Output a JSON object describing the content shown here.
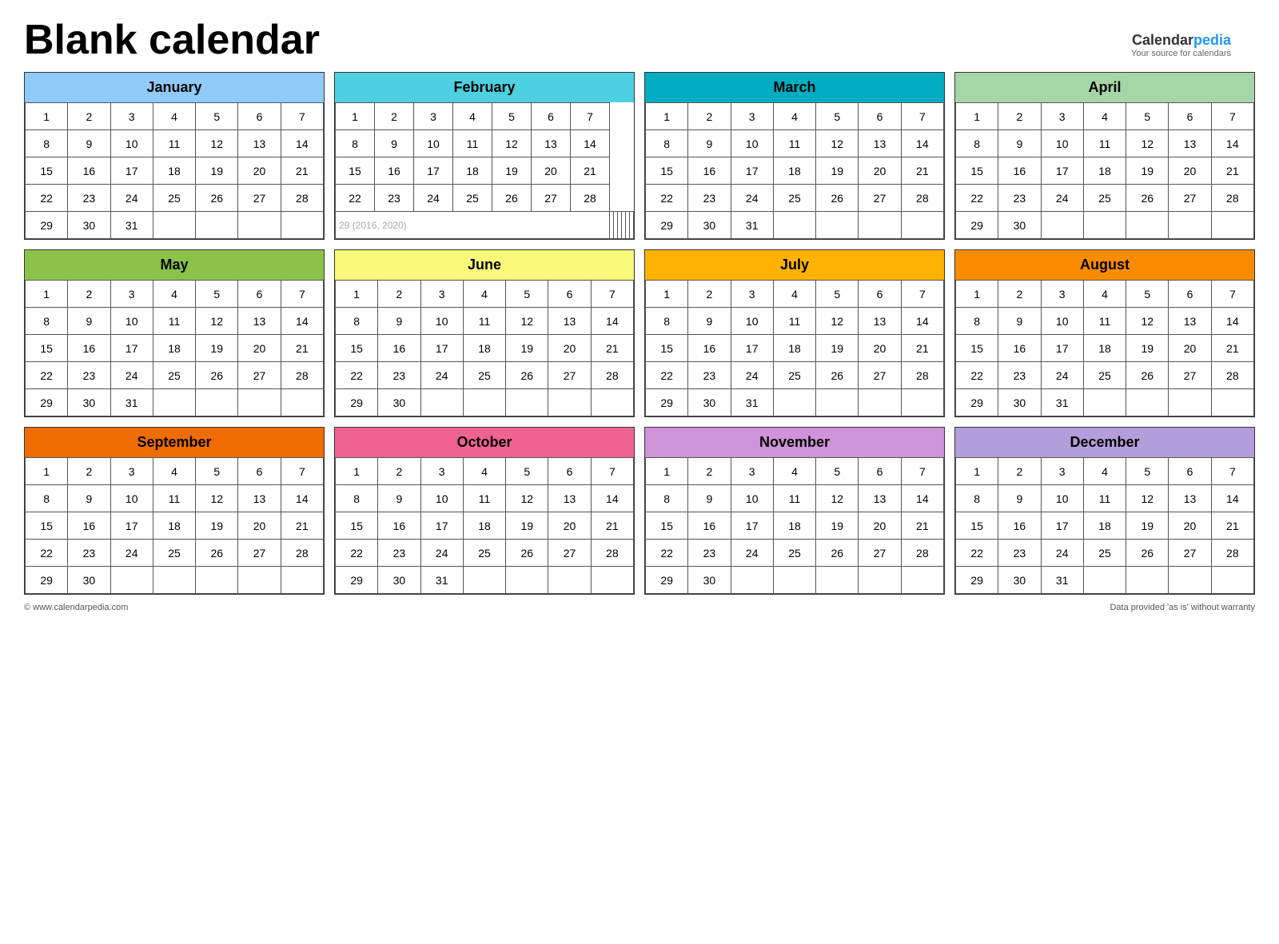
{
  "title": "Blank calendar",
  "logo": {
    "calendar": "Calendar",
    "pedia": "pedia",
    "tagline": "Your source for calendars"
  },
  "footer_left": "© www.calendarpedia.com",
  "footer_right": "Data provided 'as is' without warranty",
  "months": [
    {
      "name": "January",
      "color": "#90CAF9",
      "days": 31,
      "start": 0,
      "rows": [
        [
          1,
          2,
          3,
          4,
          5,
          6,
          7
        ],
        [
          8,
          9,
          10,
          11,
          12,
          13,
          14
        ],
        [
          15,
          16,
          17,
          18,
          19,
          20,
          21
        ],
        [
          22,
          23,
          24,
          25,
          26,
          27,
          28
        ],
        [
          29,
          30,
          31,
          "",
          "",
          "",
          ""
        ]
      ]
    },
    {
      "name": "February",
      "color": "#4DD0E1",
      "days": 28,
      "start": 3,
      "rows": [
        [
          1,
          2,
          3,
          4,
          5,
          6,
          7
        ],
        [
          8,
          9,
          10,
          11,
          12,
          13,
          14
        ],
        [
          15,
          16,
          17,
          18,
          19,
          20,
          21
        ],
        [
          22,
          23,
          24,
          25,
          26,
          27,
          28
        ],
        [
          "29_note",
          "",
          "",
          "",
          "",
          "",
          ""
        ]
      ],
      "note": "(2016, 2020)"
    },
    {
      "name": "March",
      "color": "#00ACC1",
      "days": 31,
      "rows": [
        [
          1,
          2,
          3,
          4,
          5,
          6,
          7
        ],
        [
          8,
          9,
          10,
          11,
          12,
          13,
          14
        ],
        [
          15,
          16,
          17,
          18,
          19,
          20,
          21
        ],
        [
          22,
          23,
          24,
          25,
          26,
          27,
          28
        ],
        [
          29,
          30,
          31,
          "",
          "",
          "",
          ""
        ]
      ]
    },
    {
      "name": "April",
      "color": "#A5D6A7",
      "days": 30,
      "rows": [
        [
          1,
          2,
          3,
          4,
          5,
          6,
          7
        ],
        [
          8,
          9,
          10,
          11,
          12,
          13,
          14
        ],
        [
          15,
          16,
          17,
          18,
          19,
          20,
          21
        ],
        [
          22,
          23,
          24,
          25,
          26,
          27,
          28
        ],
        [
          29,
          30,
          "",
          "",
          "",
          "",
          ""
        ]
      ]
    },
    {
      "name": "May",
      "color": "#8BC34A",
      "days": 31,
      "rows": [
        [
          1,
          2,
          3,
          4,
          5,
          6,
          7
        ],
        [
          8,
          9,
          10,
          11,
          12,
          13,
          14
        ],
        [
          15,
          16,
          17,
          18,
          19,
          20,
          21
        ],
        [
          22,
          23,
          24,
          25,
          26,
          27,
          28
        ],
        [
          29,
          30,
          31,
          "",
          "",
          "",
          ""
        ]
      ]
    },
    {
      "name": "June",
      "color": "#F9F97A",
      "days": 30,
      "rows": [
        [
          1,
          2,
          3,
          4,
          5,
          6,
          7
        ],
        [
          8,
          9,
          10,
          11,
          12,
          13,
          14
        ],
        [
          15,
          16,
          17,
          18,
          19,
          20,
          21
        ],
        [
          22,
          23,
          24,
          25,
          26,
          27,
          28
        ],
        [
          29,
          30,
          "",
          "",
          "",
          "",
          ""
        ]
      ]
    },
    {
      "name": "July",
      "color": "#FFB300",
      "days": 31,
      "rows": [
        [
          1,
          2,
          3,
          4,
          5,
          6,
          7
        ],
        [
          8,
          9,
          10,
          11,
          12,
          13,
          14
        ],
        [
          15,
          16,
          17,
          18,
          19,
          20,
          21
        ],
        [
          22,
          23,
          24,
          25,
          26,
          27,
          28
        ],
        [
          29,
          30,
          31,
          "",
          "",
          "",
          ""
        ]
      ]
    },
    {
      "name": "August",
      "color": "#FB8C00",
      "days": 31,
      "rows": [
        [
          1,
          2,
          3,
          4,
          5,
          6,
          7
        ],
        [
          8,
          9,
          10,
          11,
          12,
          13,
          14
        ],
        [
          15,
          16,
          17,
          18,
          19,
          20,
          21
        ],
        [
          22,
          23,
          24,
          25,
          26,
          27,
          28
        ],
        [
          29,
          30,
          31,
          "",
          "",
          "",
          ""
        ]
      ]
    },
    {
      "name": "September",
      "color": "#EF6C00",
      "days": 30,
      "rows": [
        [
          1,
          2,
          3,
          4,
          5,
          6,
          7
        ],
        [
          8,
          9,
          10,
          11,
          12,
          13,
          14
        ],
        [
          15,
          16,
          17,
          18,
          19,
          20,
          21
        ],
        [
          22,
          23,
          24,
          25,
          26,
          27,
          28
        ],
        [
          29,
          30,
          "",
          "",
          "",
          "",
          ""
        ]
      ]
    },
    {
      "name": "October",
      "color": "#F06292",
      "days": 31,
      "rows": [
        [
          1,
          2,
          3,
          4,
          5,
          6,
          7
        ],
        [
          8,
          9,
          10,
          11,
          12,
          13,
          14
        ],
        [
          15,
          16,
          17,
          18,
          19,
          20,
          21
        ],
        [
          22,
          23,
          24,
          25,
          26,
          27,
          28
        ],
        [
          29,
          30,
          31,
          "",
          "",
          "",
          ""
        ]
      ]
    },
    {
      "name": "November",
      "color": "#CE93D8",
      "days": 30,
      "rows": [
        [
          1,
          2,
          3,
          4,
          5,
          6,
          7
        ],
        [
          8,
          9,
          10,
          11,
          12,
          13,
          14
        ],
        [
          15,
          16,
          17,
          18,
          19,
          20,
          21
        ],
        [
          22,
          23,
          24,
          25,
          26,
          27,
          28
        ],
        [
          29,
          30,
          "",
          "",
          "",
          "",
          ""
        ]
      ]
    },
    {
      "name": "December",
      "color": "#B39DDB",
      "days": 31,
      "rows": [
        [
          1,
          2,
          3,
          4,
          5,
          6,
          7
        ],
        [
          8,
          9,
          10,
          11,
          12,
          13,
          14
        ],
        [
          15,
          16,
          17,
          18,
          19,
          20,
          21
        ],
        [
          22,
          23,
          24,
          25,
          26,
          27,
          28
        ],
        [
          29,
          30,
          31,
          "",
          "",
          "",
          ""
        ]
      ]
    }
  ]
}
